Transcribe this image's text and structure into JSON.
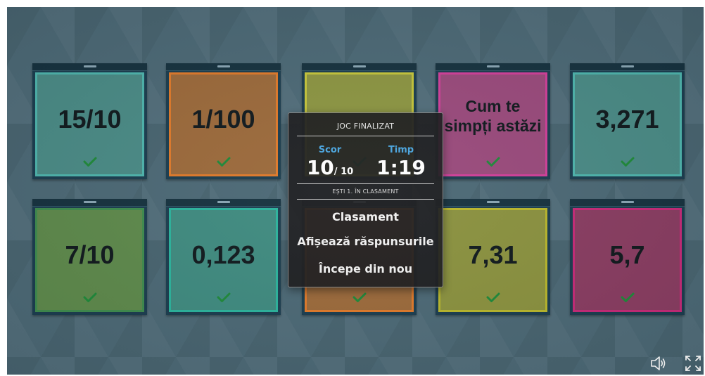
{
  "cards": [
    {
      "text": "15/10",
      "theme": "teal",
      "small": false
    },
    {
      "text": "1/100",
      "theme": "orange",
      "small": false
    },
    {
      "text": "",
      "theme": "olive",
      "small": false
    },
    {
      "text": "Cum te simpți astăzi",
      "theme": "pink",
      "small": true
    },
    {
      "text": "3,271",
      "theme": "teal",
      "small": false
    },
    {
      "text": "7/10",
      "theme": "green",
      "small": false
    },
    {
      "text": "0,123",
      "theme": "dteal",
      "small": false
    },
    {
      "text": "",
      "theme": "orange",
      "small": false
    },
    {
      "text": "7,31",
      "theme": "olive2",
      "small": false
    },
    {
      "text": "5,7",
      "theme": "maroon",
      "small": false
    }
  ],
  "modal": {
    "title": "JOC FINALIZAT",
    "score_label": "Scor",
    "score_value": "10",
    "score_total": "/ 10",
    "time_label": "Timp",
    "time_value": "1:19",
    "rank_text": "EȘTI 1. ÎN CLASAMENT",
    "leaderboard_label": "Clasament",
    "show_answers_label": "Afișează răspunsurile",
    "restart_label": "Începe din nou"
  },
  "controls": {
    "sound_icon": "speaker-icon",
    "fullscreen_icon": "fullscreen-icon"
  },
  "colors": {
    "check": "#1f8a3a",
    "accent": "#4aa6e0"
  }
}
